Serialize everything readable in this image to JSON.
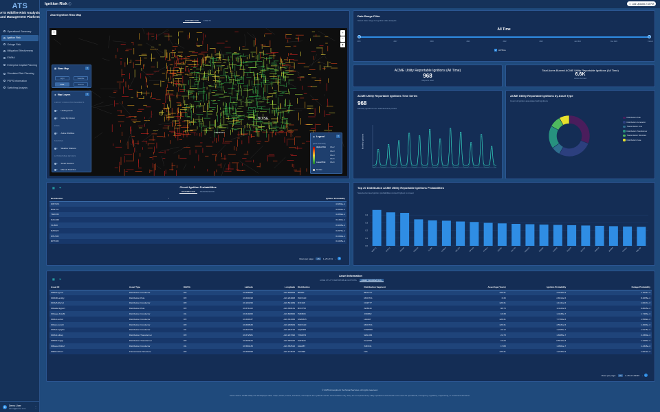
{
  "app": {
    "logo_mark": "ATS",
    "logo_text": "ATS Wildfire Risk Analysis and Management Platform"
  },
  "nav": [
    {
      "label": "Operational Summary",
      "active": false
    },
    {
      "label": "Ignition Risk",
      "active": true
    },
    {
      "label": "Outage Risk",
      "active": false
    },
    {
      "label": "Mitigation Effectiveness",
      "active": false
    },
    {
      "label": "EWMA",
      "active": false
    },
    {
      "label": "Enterprise Capital Planning",
      "active": false
    },
    {
      "label": "Simulated Risk Planning",
      "active": false
    },
    {
      "label": "PSPS Information",
      "active": false
    },
    {
      "label": "Switching Analysis",
      "active": false
    }
  ],
  "user": {
    "initials": "D",
    "name": "Demo User",
    "email": "demo@acme.com"
  },
  "header": {
    "title": "Ignition Risk",
    "last_updated": "Last Updated 2:33 PM"
  },
  "map": {
    "title": "Asset Ignition Risk Map",
    "tabs": [
      "DISTRIBUTION",
      "ASSETS"
    ],
    "city_label_1": "BOISE",
    "city_label_2": "MERIDIAN",
    "base_map": {
      "title": "Base Map",
      "options": [
        "Light",
        "Satellite",
        "Dark",
        "Streets"
      ],
      "selected": "Dark"
    },
    "layers": {
      "title": "Map Layers",
      "groups": [
        {
          "heading": "CIRCUIT CONDUCTOR SEGMENTS",
          "items": [
            "Underground",
            "Color By Circuit"
          ]
        },
        {
          "heading": "FIRES",
          "items": [
            "Active Wildfires"
          ]
        },
        {
          "heading": "STATIONS",
          "items": [
            "Weather Stations"
          ]
        },
        {
          "heading": "AUTOMATABLE DEVICES",
          "items": [
            "Smart Devices",
            "Manual Switches"
          ]
        }
      ]
    },
    "legend": {
      "title": "Legend",
      "heading": "Ignition Probability",
      "high": "Highest Risk",
      "low": "Lowest Risk",
      "no_data": "No Data",
      "ticks": [
        "1.0e-2",
        "1.0e-3",
        "1.0e-4",
        "1.0e-5",
        "1.0e-6"
      ]
    },
    "zoom_in": "+",
    "zoom_out": "−",
    "compass": "◆",
    "fullscreen": "⛶"
  },
  "date_range": {
    "title": "Date Range Filter",
    "subtitle": "Select date range for ignition data analysis",
    "label": "All Time",
    "ticks": [
      "2015",
      "2017",
      "2019",
      "2021",
      "2022",
      "2023",
      "Jan 2024",
      "Dec 2024",
      "Current"
    ],
    "checkbox": "All Time"
  },
  "stats": {
    "reportable": {
      "title": "ACME Utility Reportable Ignitions (All Time)",
      "value": "968",
      "caption": "Reports total"
    },
    "acres": {
      "title": "Total Acres Burned ACME Utility Reportable Ignitions (All Time)",
      "value": "6.6K",
      "caption": "Acres burned"
    }
  },
  "timeseries": {
    "title": "ACME Utility Reportable Ignitions Time Series",
    "value": "968",
    "subtitle": "Monthly ignitions over selected time period",
    "ylabel": "Monthly Ignitions"
  },
  "asset_type": {
    "title": "ACME Utility Reportable Ignitions by Asset Type",
    "subtitle": "Count of ignition associated with ignitions",
    "legend": [
      {
        "name": "Distribution Pole",
        "color": "#4a1d5c"
      },
      {
        "name": "Distribution Conductor",
        "color": "#2c3f7e"
      },
      {
        "name": "Transmission Line",
        "color": "#2e6e8e"
      },
      {
        "name": "Distribution Transformer",
        "color": "#27927f"
      },
      {
        "name": "Transmission Structure",
        "color": "#4fba5e"
      },
      {
        "name": "Distribution Fuse",
        "color": "#e8e12c"
      }
    ]
  },
  "circuit": {
    "title": "Circuit Ignition Probabilities",
    "tabs": [
      "DISTRIBUTION",
      "TRANSMISSION"
    ],
    "columns": [
      "Distribution",
      "Ignition Probability"
    ],
    "rows": [
      [
        "WNT471",
        "4.6651e-1"
      ],
      [
        "BCE711",
        "4.3541e-1"
      ],
      [
        "YED336",
        "4.2832e-1"
      ],
      [
        "DAG346",
        "3.4460e-1"
      ],
      [
        "VLI660",
        "3.3035e-1"
      ],
      [
        "RZX023",
        "3.2673e-1"
      ],
      [
        "MTL545",
        "3.1640e-1"
      ],
      [
        "RPT345",
        "3.1005e-1"
      ]
    ],
    "rows_per_page_label": "Rows per page:",
    "rows_per_page": "25",
    "range": "1–25 of 61"
  },
  "top20": {
    "title": "Top 20 Distribution ACME Utility Reportable Ignitions Probabilities",
    "subtitle": "Selected annual ignition probabilities ranked highest to lowest"
  },
  "chart_data": {
    "type": "bar",
    "categories": [
      "WNT471",
      "BCE711",
      "YED336",
      "DAG346",
      "VLI660",
      "RZX023",
      "MTL545",
      "RPT345",
      "AVN214",
      "JKD862",
      "OPL733",
      "HRW128",
      "SXD994",
      "KLM402",
      "TPQ519",
      "BNV367",
      "CXE810",
      "ZRT655",
      "FGH221",
      "QWL480"
    ],
    "values": [
      0.4665,
      0.4354,
      0.4283,
      0.3446,
      0.3304,
      0.3267,
      0.3164,
      0.3101,
      0.2989,
      0.2921,
      0.2856,
      0.281,
      0.2762,
      0.2721,
      0.2684,
      0.2641,
      0.2598,
      0.2554,
      0.2512,
      0.247
    ],
    "yticks": [
      "0.4",
      "0.3",
      "0.2",
      "0.1",
      "0.0"
    ],
    "ylim": [
      0,
      0.5
    ]
  },
  "assets": {
    "title": "Asset Information",
    "tabs": [
      "ACME UTILITY REPORTABLE IGNITIONS",
      "ASSET INFORMATION"
    ],
    "columns": [
      "Asset ID",
      "Asset Type",
      "OH/UG",
      "Latitude",
      "Longitude",
      "Distribution",
      "Distribution Segment",
      "Asset Age (Years)",
      "Ignition Probability",
      "Outage Probability"
    ],
    "rows": [
      [
        "000fab-qjrms",
        "Distribution Conductor",
        "OH",
        "43.658365",
        "-116.508054",
        "BP800",
        "BNG717",
        "126.31",
        "4.3343e-5",
        "1.3011e-3"
      ],
      [
        "003b8b-ambjy",
        "Distribution Pole",
        "OH",
        "43.660198",
        "-116.264908",
        "WSX120",
        "MCD731",
        "6.45",
        "2.8314e-5",
        "8.2658e-4"
      ],
      [
        "001fe5-9hyvd",
        "Distribution Conductor",
        "OH",
        "43.164150",
        "-116.521969",
        "IFO198",
        "OFZ777",
        "126.31",
        "1.1341e-5",
        "1.0047e-3"
      ],
      [
        "002a8e-9gpczt",
        "Distribution Pole",
        "OH",
        "43.671402",
        "-116.330161",
        "BXO753",
        "AR6344",
        "88.73",
        "2.1122e-5",
        "6.8025e-4"
      ],
      [
        "003aae-3vtw8t",
        "Distribution Conductor",
        "UG",
        "43.619260",
        "-116.600862",
        "HZD803",
        "JXD862",
        "16.38",
        "1.4338e-7",
        "1.7483e-4"
      ],
      [
        "004bd-suthxf",
        "Distribution Conductor",
        "OH",
        "43.660337",
        "-116.333456",
        "NWD825",
        "LEG48",
        "126.31",
        "7.7353e-5",
        "1.5582e-3"
      ],
      [
        "003ab-nsnxbl",
        "Distribution Conductor",
        "OH",
        "43.660530",
        "-116.260609",
        "WSX120",
        "MCD731",
        "126.31",
        "4.5631e-5",
        "1.3063e-3"
      ],
      [
        "004fe4-lqagha",
        "Distribution Conductor",
        "UG",
        "43.647184",
        "-116.263710",
        "AQD384",
        "DSW096",
        "24.12",
        "1.2483e-7",
        "1.5175e-4"
      ],
      [
        "004fc2-sltlap",
        "Distribution Transformer",
        "OH",
        "43.672581",
        "-116.247492",
        "YWA872",
        "WAL364",
        "21.78",
        "1.8285e-7",
        "2.3360e-4"
      ],
      [
        "005f04-bqjqp",
        "Distribution Transformer",
        "OH",
        "43.663634",
        "-116.365332",
        "NZH023",
        "KGZ765",
        "15.29",
        "8.5610e-8",
        "1.2283e-4"
      ],
      [
        "006ace-8b1fef",
        "Distribution Conductor",
        "UG",
        "43.584135",
        "-116.352512",
        "ALE387",
        "XZF341",
        "17.88",
        "1.0561e-7",
        "1.4326e-4"
      ],
      [
        "0060b-hlhm7",
        "Transmission Structure",
        "OH",
        "43.650398",
        "-116.173676",
        "TLK098",
        "N/A",
        "126.31",
        "1.2345e-5",
        "1.0012e-3"
      ]
    ],
    "rows_per_page_label": "Rows per page:",
    "rows_per_page": "25",
    "range": "1–25 of 123415"
  },
  "footer": {
    "line1": "© 2025 Atmospheric Technical Services. All rights reserved.",
    "line2": "Demo Notice: ACME Utility and all displayed data, maps, assets, events, scenarios, and outputs are synthetic and for demonstration only. They do not represent any utility operations and should not be used for operational, emergency, regulatory, engineering, or investment decisions."
  }
}
